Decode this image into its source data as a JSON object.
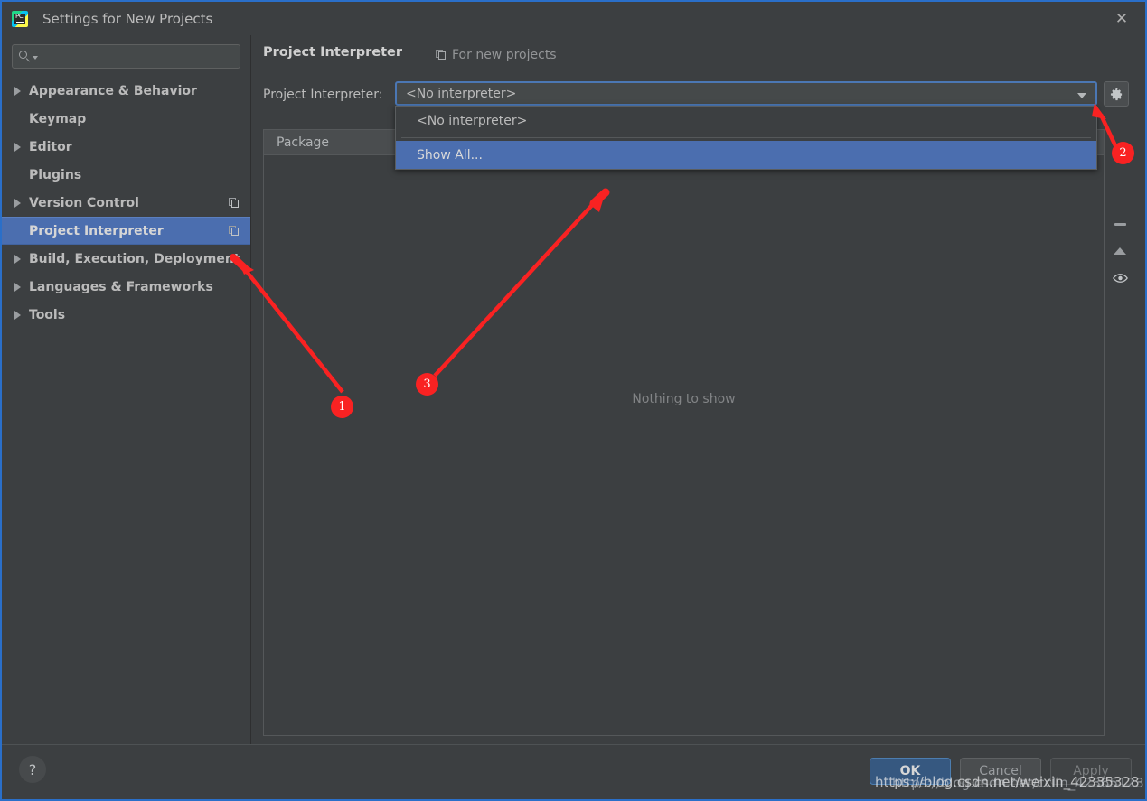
{
  "window": {
    "title": "Settings for New Projects",
    "app_icon": "pycharm-logo",
    "close_icon": "✕"
  },
  "sidebar": {
    "search": {
      "placeholder": "",
      "value": "",
      "icon": "search-icon"
    },
    "items": [
      {
        "label": "Appearance & Behavior",
        "expandable": true,
        "selected": false,
        "copy_icon": false
      },
      {
        "label": "Keymap",
        "expandable": false,
        "selected": false,
        "copy_icon": false
      },
      {
        "label": "Editor",
        "expandable": true,
        "selected": false,
        "copy_icon": false
      },
      {
        "label": "Plugins",
        "expandable": false,
        "selected": false,
        "copy_icon": false
      },
      {
        "label": "Version Control",
        "expandable": true,
        "selected": false,
        "copy_icon": true
      },
      {
        "label": "Project Interpreter",
        "expandable": false,
        "selected": true,
        "copy_icon": true
      },
      {
        "label": "Build, Execution, Deployment",
        "expandable": true,
        "selected": false,
        "copy_icon": false
      },
      {
        "label": "Languages & Frameworks",
        "expandable": true,
        "selected": false,
        "copy_icon": false
      },
      {
        "label": "Tools",
        "expandable": true,
        "selected": false,
        "copy_icon": false
      }
    ]
  },
  "content": {
    "title": "Project Interpreter",
    "scope_label": "For new projects",
    "scope_icon": "copy-scope-icon",
    "interpreter_label": "Project Interpreter:",
    "interpreter_value": "<No interpreter>",
    "gear_icon": "gear-icon",
    "dropdown": {
      "open": true,
      "options": [
        {
          "label": "<No interpreter>",
          "highlighted": false
        },
        {
          "label": "Show All...",
          "highlighted": true
        }
      ]
    },
    "packages_table": {
      "columns": [
        "Package"
      ],
      "rows": [],
      "empty_text": "Nothing to show"
    },
    "toolbar": [
      {
        "icon": "minus-icon",
        "name": "remove-package-button"
      },
      {
        "icon": "up-arrow-icon",
        "name": "upgrade-package-button"
      },
      {
        "icon": "eye-icon",
        "name": "show-early-releases-button"
      }
    ]
  },
  "footer": {
    "help_label": "?",
    "ok_label": "OK",
    "cancel_label": "Cancel",
    "apply_label": "Apply"
  },
  "watermark": {
    "line_a": "https://blog.csdn.net/weixin_42335328",
    "line_b": "https://blog.csdn.net/cclin_42365123"
  },
  "annotations": [
    {
      "number": "1"
    },
    {
      "number": "2"
    },
    {
      "number": "3"
    }
  ],
  "colors": {
    "window_bg": "#3c3f41",
    "selection_blue": "#4b6eaf",
    "focus_border": "#4b77b4",
    "annotation_red": "#f92222",
    "ok_button": "#365880"
  }
}
